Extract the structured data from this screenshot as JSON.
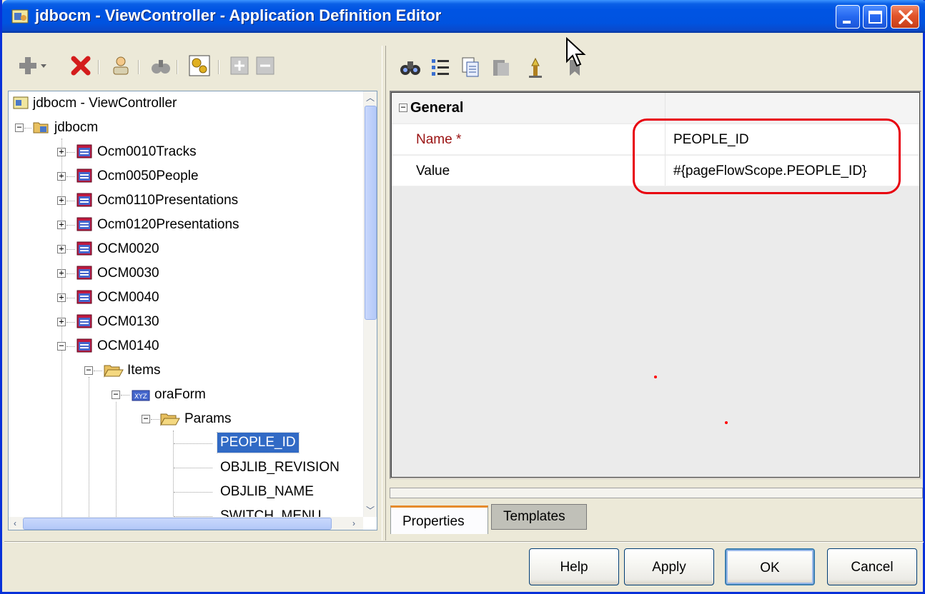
{
  "window": {
    "title": "jdbocm - ViewController - Application Definition Editor"
  },
  "left_toolbar": {
    "icons": [
      "add-icon",
      "delete-icon",
      "user-icon",
      "binoculars-icon",
      "wizard-icon",
      "expand-all-icon",
      "collapse-all-icon"
    ]
  },
  "tree": {
    "items": [
      {
        "label": "jdbocm - ViewController"
      },
      {
        "label": "jdbocm"
      },
      {
        "label": "Ocm0010Tracks"
      },
      {
        "label": "Ocm0050People"
      },
      {
        "label": "Ocm0110Presentations"
      },
      {
        "label": "Ocm0120Presentations"
      },
      {
        "label": "OCM0020"
      },
      {
        "label": "OCM0030"
      },
      {
        "label": "OCM0040"
      },
      {
        "label": "OCM0130"
      },
      {
        "label": "OCM0140"
      },
      {
        "label": "Items"
      },
      {
        "label": "oraForm"
      },
      {
        "label": "Params"
      },
      {
        "label": "PEOPLE_ID"
      },
      {
        "label": "OBJLIB_REVISION"
      },
      {
        "label": "OBJLIB_NAME"
      },
      {
        "label": "SWITCH_MENU"
      }
    ]
  },
  "properties": {
    "section": "General",
    "rows": [
      {
        "name": "Name",
        "required_mark": "*",
        "value": "PEOPLE_ID"
      },
      {
        "name": "Value",
        "value": "#{pageFlowScope.PEOPLE_ID}"
      }
    ]
  },
  "tabs": [
    {
      "label": "Properties",
      "active": true
    },
    {
      "label": "Templates",
      "active": false
    }
  ],
  "buttons": {
    "help": "Help",
    "apply": "Apply",
    "ok": "OK",
    "cancel": "Cancel"
  },
  "colors": {
    "titlebar": "#0054e3",
    "selection": "#316ac5",
    "highlight_oval": "#e8000e",
    "required_label": "#9a1111"
  }
}
